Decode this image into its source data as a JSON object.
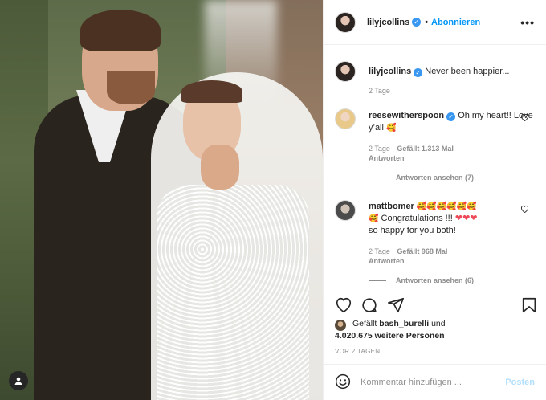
{
  "post": {
    "author": "lilyjcollins",
    "follow_label": "Abonnieren",
    "dot": "•",
    "more_label": "•••",
    "caption": "Never been happier...",
    "caption_time": "2 Tage",
    "verified_mark": "✓"
  },
  "comments": [
    {
      "user": "reesewitherspoon",
      "text": "Oh my heart!! Love y’all",
      "emoji": "🥰",
      "time": "2 Tage",
      "likes": "Gefällt 1.313 Mal",
      "reply": "Antworten",
      "view_replies": "Antworten ansehen (7)"
    },
    {
      "user": "mattbomer",
      "emoji_line1": "🥰🥰🥰🥰🥰🥰",
      "emoji_line2": "🥰",
      "text": "Congratulations !!!",
      "hearts": "❤❤❤",
      "text2": "so happy for you both!",
      "time": "2 Tage",
      "likes": "Gefällt 968 Mal",
      "reply": "Antworten",
      "view_replies": "Antworten ansehen (6)"
    }
  ],
  "likes_summary": {
    "prefix": "Gefällt",
    "user": "bash_burelli",
    "connector": "und",
    "count": "4.020.675 weitere Personen"
  },
  "timestamp": "VOR 2 TAGEN",
  "add_comment": {
    "placeholder": "Kommentar hinzufügen ...",
    "post_label": "Posten"
  },
  "icons": {
    "like": "heart-icon",
    "comment": "comment-icon",
    "share": "share-icon",
    "save": "bookmark-icon",
    "more": "more-icon",
    "emoji": "emoji-icon",
    "photo_user": "user-icon"
  },
  "colors": {
    "accent": "#0095f6",
    "verified": "#3897f0",
    "muted": "#8e8e8e",
    "border": "#efefef",
    "post_disabled": "#b2dffc",
    "heart": "#ed4956"
  }
}
